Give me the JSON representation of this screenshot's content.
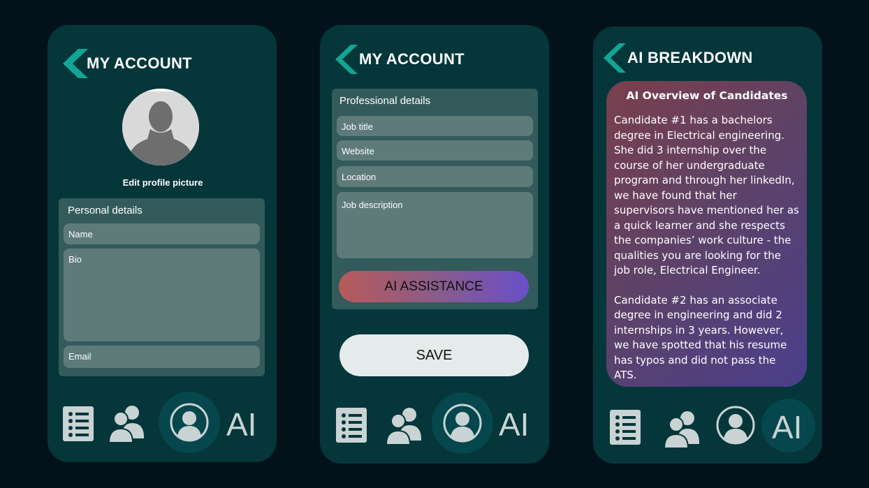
{
  "colors": {
    "background": "#03121a",
    "phone": "#04363a",
    "accent": "#12a595",
    "panel": "#335b5c",
    "field": "#5e7b7a",
    "icon": "#c9d3d3"
  },
  "screen1": {
    "title": "MY ACCOUNT",
    "edit_picture": "Edit profile picture",
    "section_title": "Personal details",
    "fields": {
      "name": "Name",
      "bio": "Bio",
      "email": "Email"
    }
  },
  "screen2": {
    "title": "MY ACCOUNT",
    "section_title": "Professional details",
    "fields": {
      "job_title": "Job title",
      "website": "Website",
      "location": "Location",
      "job_description": "Job description"
    },
    "ai_button": "AI ASSISTANCE",
    "save_button": "SAVE"
  },
  "screen3": {
    "title": "AI BREAKDOWN",
    "card_title": "AI Overview of Candidates",
    "paragraphs": [
      "Candidate #1 has a bachelors degree in Electrical engineering. She did 3 internship over the course of her undergraduate program and through her linkedIn, we have found that her supervisors have mentioned her as a quick learner and she respects the companies’ work culture - the qualities you are looking for the job role, Electrical Engineer.",
      "Candidate #2 has an associate degree in engineering and did 2 internships in 3 years. However, we have spotted that his resume has typos and did not pass the ATS."
    ]
  },
  "nav": {
    "ai_label": "AI",
    "icons": [
      "list-icon",
      "users-icon",
      "profile-icon",
      "ai-text"
    ],
    "active": {
      "screen1": "profile",
      "screen2": "profile",
      "screen3": "ai"
    }
  }
}
